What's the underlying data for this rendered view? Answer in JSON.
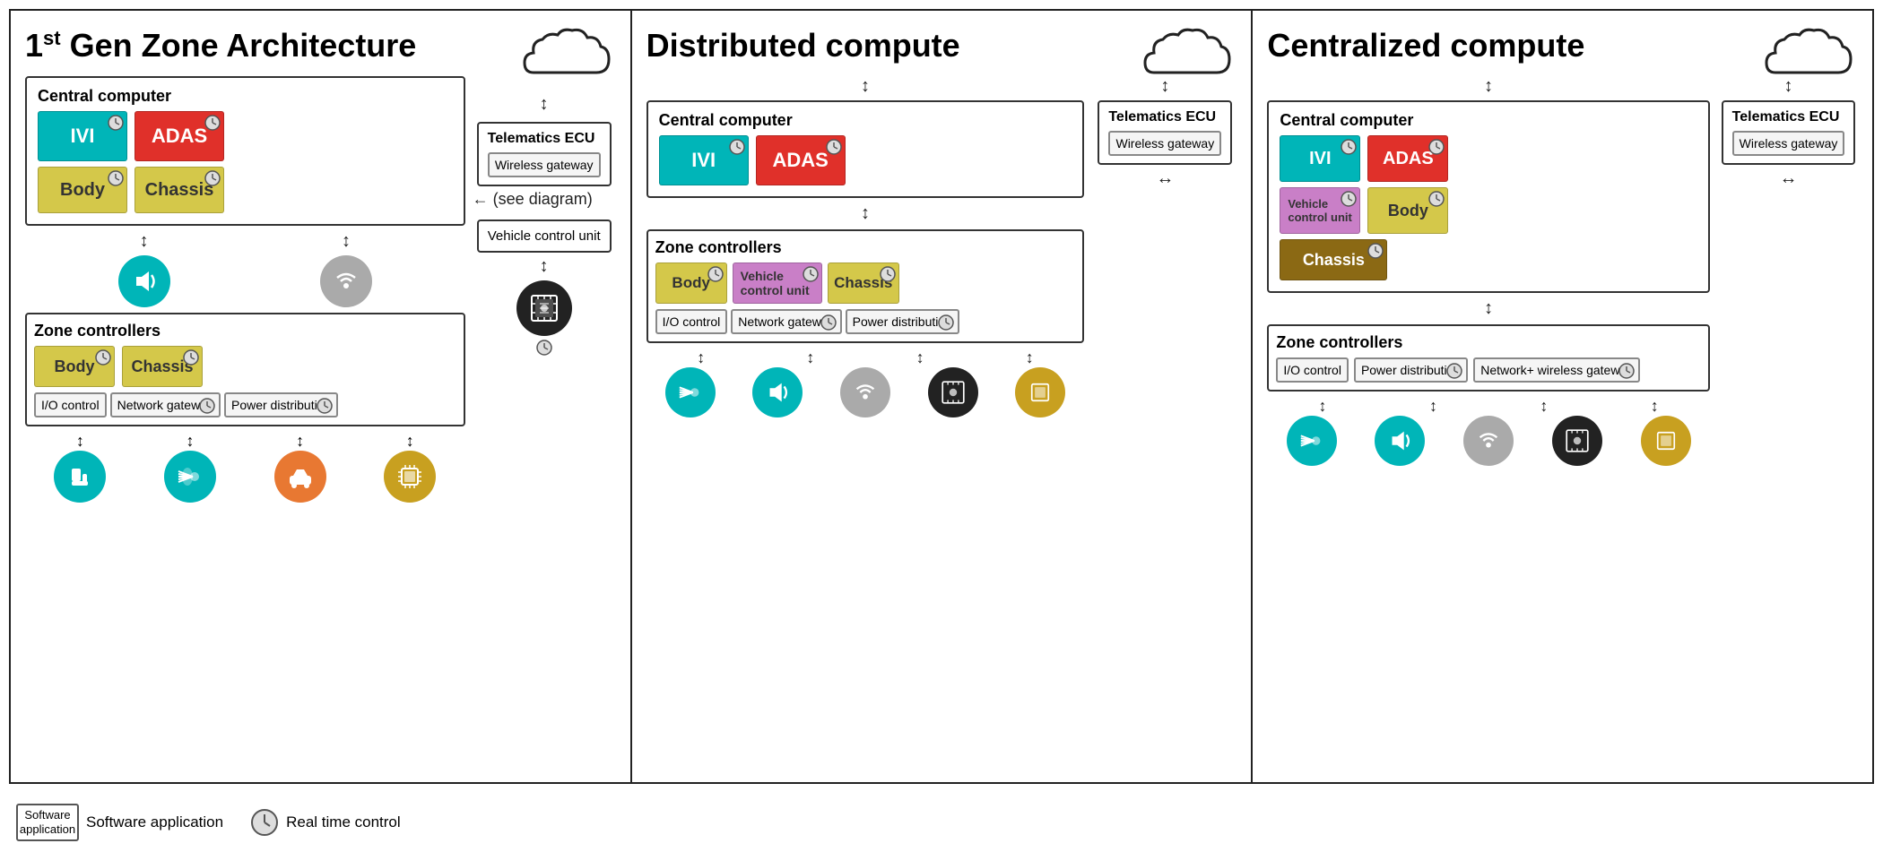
{
  "panel1": {
    "title": "1",
    "title_sup": "st",
    "title_rest": " Gen Zone Architecture",
    "central_computer": "Central computer",
    "ivi": "IVI",
    "adas": "ADAS",
    "body": "Body",
    "chassis": "Chassis",
    "telematics_ecu": "Telematics ECU",
    "wireless_gateway": "Wireless gateway",
    "vehicle_control_unit": "Vehicle control unit",
    "zone_controllers": "Zone controllers",
    "io_control": "I/O control",
    "network_gateway": "Network gateway",
    "power_distribution": "Power distribution"
  },
  "panel2": {
    "title": "Distributed compute",
    "central_computer": "Central computer",
    "ivi": "IVI",
    "adas": "ADAS",
    "telematics_ecu": "Telematics ECU",
    "wireless_gateway": "Wireless gateway",
    "zone_controllers": "Zone controllers",
    "body": "Body",
    "vehicle_control_unit": "Vehicle control unit",
    "chassis": "Chassis",
    "io_control": "I/O control",
    "network_gateway": "Network gateway",
    "power_distribution": "Power distribution"
  },
  "panel3": {
    "title": "Centralized compute",
    "central_computer": "Central computer",
    "ivi": "IVI",
    "adas": "ADAS",
    "vehicle_control_unit": "Vehicle control unit",
    "body": "Body",
    "chassis": "Chassis",
    "telematics_ecu": "Telematics ECU",
    "wireless_gateway": "Wireless gateway",
    "zone_controllers": "Zone controllers",
    "io_control": "I/O control",
    "power_distribution": "Power distribution",
    "network_wireless_gateway": "Network+ wireless gateway"
  },
  "legend": {
    "software_application": "Software application",
    "real_time_control": "Real time control"
  }
}
